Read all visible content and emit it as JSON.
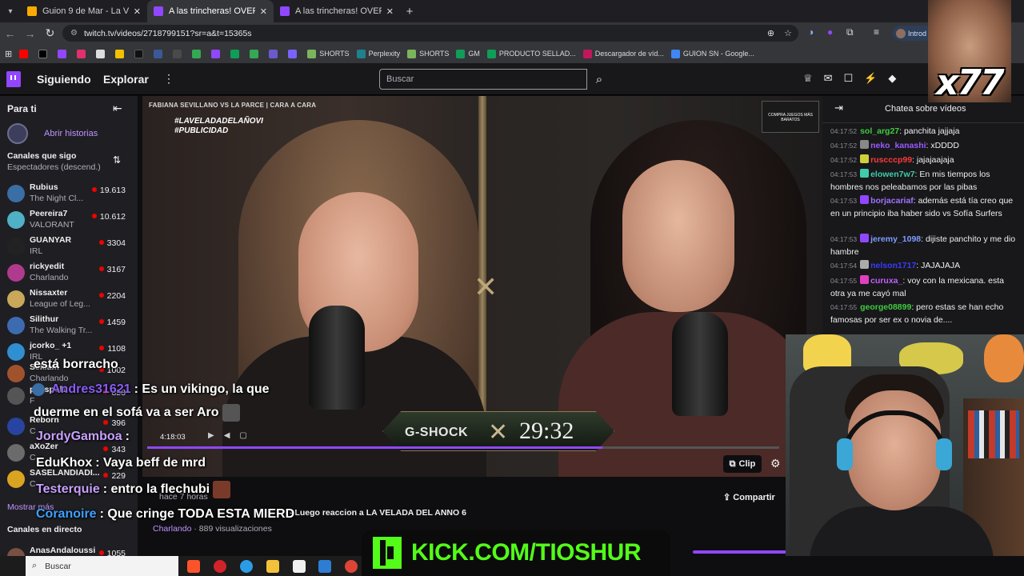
{
  "browser": {
    "tabs": [
      {
        "title": "Guion 9 de Mar - La Velada - P",
        "active": false,
        "color": "#f9ab00"
      },
      {
        "title": "A las trincheras! OVER THE",
        "active": true,
        "color": "#9147ff"
      },
      {
        "title": "A las trincheras! OVER THE TOP",
        "active": false,
        "color": "#9147ff"
      }
    ],
    "url": "twitch.tv/videos/2718799151?sr=a&t=15365s",
    "profile_label": "Introd",
    "bookmarks": [
      "SHORTS",
      "Perplexity",
      "SHORTS",
      "GM",
      "PRODUCTO SELLAD...",
      "Descargador de víd...",
      "GUION SN - Google..."
    ]
  },
  "twitch_nav": {
    "following": "Siguiendo",
    "browse": "Explorar",
    "search_placeholder": "Buscar"
  },
  "sidebar": {
    "header": "Para ti",
    "history_link": "Abrir historias",
    "section": "Canales que sigo",
    "sort": "Espectadores (descend.)",
    "channels": [
      {
        "name": "Rubius",
        "game": "The Night Cl...",
        "viewers": "19.613",
        "color": "#3a6ea5"
      },
      {
        "name": "Peereira7",
        "game": "VALORANT",
        "viewers": "10.612",
        "color": "#4fb0c6"
      },
      {
        "name": "GUANYAR",
        "game": "IRL",
        "viewers": "3304",
        "color": "#222222"
      },
      {
        "name": "rickyedit",
        "game": "Charlando",
        "viewers": "3167",
        "color": "#b03a8e"
      },
      {
        "name": "Nissaxter",
        "game": "League of Leg...",
        "viewers": "2204",
        "color": "#c9a85a"
      },
      {
        "name": "Silithur",
        "game": "The Walking Tr...",
        "viewers": "1459",
        "color": "#3d6bb0"
      },
      {
        "name": "jcorko_ +1",
        "game": "IRL",
        "viewers": "1108",
        "color": "#2f8fd0"
      },
      {
        "name": "Sekiam",
        "game": "Charlando",
        "viewers": "1002",
        "color": "#a0522d"
      },
      {
        "name": "polispol1",
        "game": "F",
        "viewers": "858",
        "color": "#555555"
      },
      {
        "name": "Reborn",
        "game": "C",
        "viewers": "396",
        "color": "#2844a0"
      },
      {
        "name": "aXoZer",
        "game": "C",
        "viewers": "343",
        "color": "#6b6b6b"
      },
      {
        "name": "SASELANDIADI...",
        "game": "C",
        "viewers": "229",
        "color": "#d9a520"
      }
    ],
    "show_more": "Mostrar más",
    "live_section": "Canales en directo",
    "live_channels": [
      {
        "name": "AnasAndaloussi",
        "viewers": "1055",
        "color": "#7a5040"
      }
    ]
  },
  "video": {
    "overline": "FABIANA SEVILLANO VS LA PARCE | CARA A CARA",
    "hashtag1": "#LAVELADADELAÑOVI",
    "hashtag2": "#PUBLICIDAD",
    "sponsor_text": "COMPRA JUEGOS MÁS BARATOS",
    "timer_brand": "G-SHOCK",
    "timer_time": "29:32",
    "current_time": "4:18:03",
    "progress": 0.72,
    "clip_label": "Clip",
    "share_label": "Compartir",
    "posted": "hace 7 horas",
    "title": "- Luego reaccion a LA VELADA DEL ANNO 6",
    "category": "Charlando",
    "views": "· 889 visualizaciones"
  },
  "overlay_chat": [
    {
      "user": "",
      "text": "está borracho",
      "user_color": "#ffffff"
    },
    {
      "user": "Andres31621",
      "text": ": Es un vikingo, la que",
      "user_color": "#8a5cf6"
    },
    {
      "user": "",
      "text": "duerme en el sofá va a ser Aro",
      "user_color": "#ffffff"
    },
    {
      "user": "JordyGamboa",
      "text": ":",
      "user_color": "#c8a0ff"
    },
    {
      "user": "EduKhox",
      "text": ": Vaya beff de mrd",
      "user_color": "#ffffff"
    },
    {
      "user": "Testerquie",
      "text": ": entro la flechubi",
      "user_color": "#c8a0ff"
    },
    {
      "user": "Coranoire",
      "text": ": Que cringe TODA ESTA MIERD",
      "user_color": "#3fa0ff"
    }
  ],
  "chat": {
    "title": "Chatea sobre vídeos",
    "messages": [
      {
        "time": "04:17:52",
        "user": "sol_arg27",
        "color": "#3fcc3f",
        "text": ": panchita jajjaja",
        "badge": ""
      },
      {
        "time": "04:17:52",
        "user": "neko_kanashi",
        "color": "#9b59ff",
        "text": ": xDDDD",
        "badge": "#888888"
      },
      {
        "time": "04:17:52",
        "user": "ruscccp99",
        "color": "#ff3a3a",
        "text": ": jajajaajaja",
        "badge": "#cfcf3a"
      },
      {
        "time": "04:17:53",
        "user": "elowen7w7",
        "color": "#3fccaa",
        "text": ": En mis tiempos los hombres nos peleabamos por las pibas",
        "badge": "#3fccaa"
      },
      {
        "time": "04:17:53",
        "user": "borjacariaf",
        "color": "#a070ff",
        "text": ": además está tía creo que en un principio iba haber sido vs Sofía Surfers",
        "badge": "#9147ff"
      },
      {
        "time": "04:17:53",
        "user": "jeremy_1098",
        "color": "#7f9cff",
        "text": ": dijiste panchito y me dio hambre",
        "badge": "#9147ff"
      },
      {
        "time": "04:17:54",
        "user": "nelson1717",
        "color": "#3a3aff",
        "text": ": JAJAJAJA",
        "badge": "#aaaaaa"
      },
      {
        "time": "04:17:55",
        "user": "curuxa_",
        "color": "#c060ff",
        "text": ": voy con la mexicana. esta otra ya me cayó mal",
        "badge": "#e040c0"
      },
      {
        "time": "04:17:55",
        "user": "george08899",
        "color": "#3fcc3f",
        "text": ": pero estas se han echo famosas por ser ex o novia de....",
        "badge": ""
      }
    ]
  },
  "meme_text": "x77",
  "kick_banner": "KICK.COM/TIOSHUR",
  "taskbar": {
    "search": "Buscar"
  },
  "colors": {
    "twitch_purple": "#9147ff",
    "kick_green": "#53fc18",
    "live_red": "#eb0400"
  }
}
